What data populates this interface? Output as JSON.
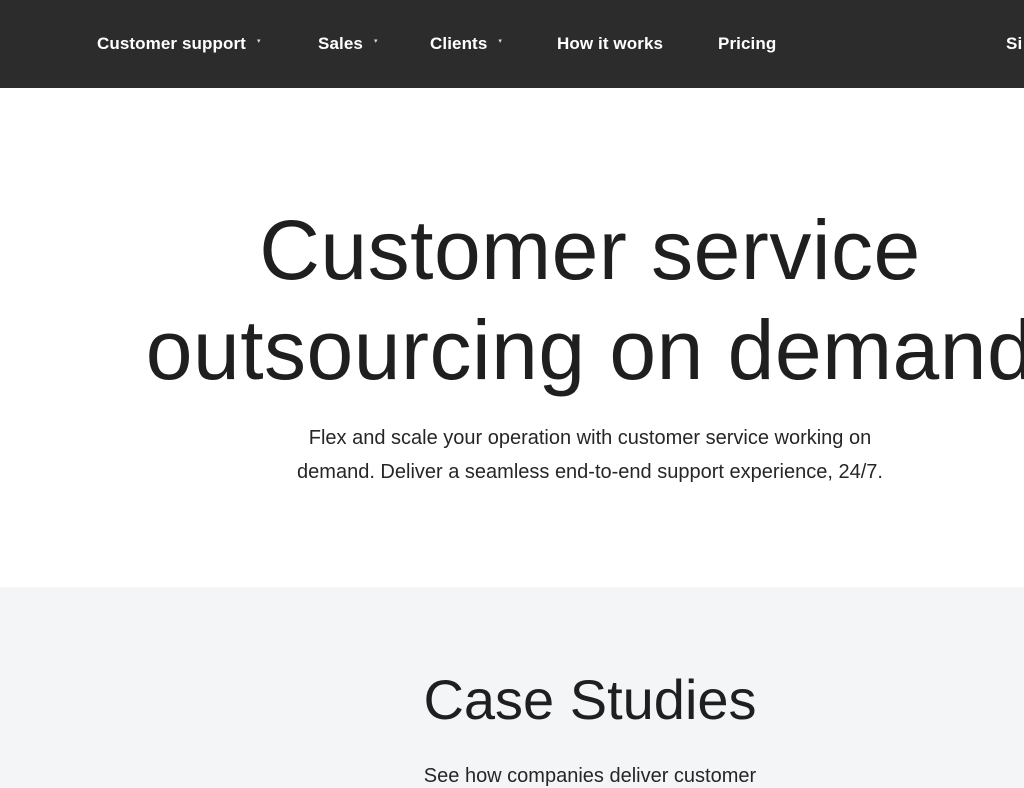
{
  "nav": {
    "items": [
      {
        "label": "Customer support",
        "has_dropdown": true
      },
      {
        "label": "Sales",
        "has_dropdown": true
      },
      {
        "label": "Clients",
        "has_dropdown": true
      },
      {
        "label": "How it works",
        "has_dropdown": false
      },
      {
        "label": "Pricing",
        "has_dropdown": false
      }
    ],
    "signin_partial": "Si",
    "caret_glyph": "▾",
    "background": "#2c2c2c"
  },
  "hero": {
    "title_line1": "Customer service",
    "title_line2": "outsourcing on demand",
    "subtitle_line1": "Flex and scale your operation with customer service working on",
    "subtitle_line2": "demand. Deliver a seamless end-to-end support experience, 24/7."
  },
  "cases": {
    "title": "Case Studies",
    "subtitle": "See how companies deliver customer",
    "background": "#f4f5f7"
  }
}
